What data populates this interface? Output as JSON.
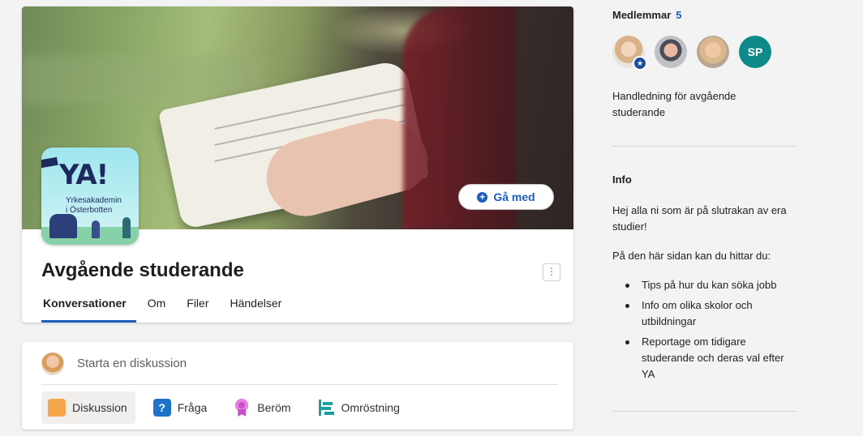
{
  "group": {
    "logo": {
      "title": "YA!",
      "subtitle_line1": "Yrkesakademin",
      "subtitle_line2": "i Österbotten"
    },
    "name": "Avgående studerande",
    "join_label": "Gå med",
    "more_label": "⋮",
    "tabs": [
      {
        "label": "Konversationer",
        "active": true
      },
      {
        "label": "Om"
      },
      {
        "label": "Filer"
      },
      {
        "label": "Händelser"
      }
    ]
  },
  "composer": {
    "placeholder": "Starta en diskussion",
    "post_types": [
      {
        "label": "Diskussion",
        "icon": "discussion-icon",
        "selected": true
      },
      {
        "label": "Fråga",
        "icon": "question-icon"
      },
      {
        "label": "Beröm",
        "icon": "praise-icon"
      },
      {
        "label": "Omröstning",
        "icon": "poll-icon"
      }
    ]
  },
  "sidebar": {
    "members_label": "Medlemmar",
    "members_count": "5",
    "member_initials": "SP",
    "description": "Handledning för avgående studerande",
    "info_heading": "Info",
    "info_p1": "Hej alla ni som är på slutrakan av era studier!",
    "info_p2": "På den här sidan kan du hittar du:",
    "info_items": [
      "Tips på hur du kan söka jobb",
      "Info om olika skolor och utbildningar",
      "Reportage om tidigare studerande och deras val efter YA"
    ]
  },
  "colors": {
    "accent": "#1b5fbd",
    "page_background": "#f3f3f3",
    "member_sp": "#0e8a8a"
  }
}
